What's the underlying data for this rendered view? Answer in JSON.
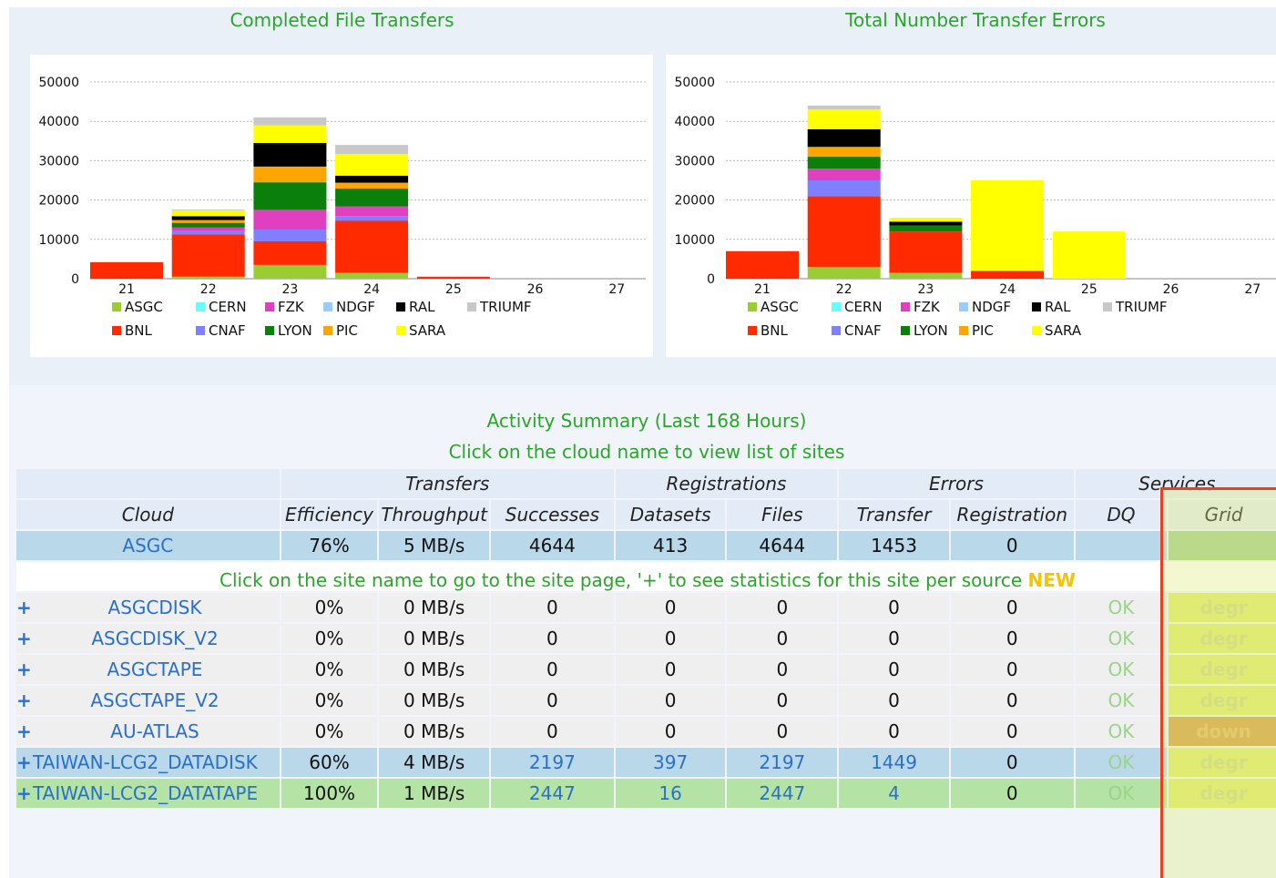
{
  "charts": [
    {
      "title": "Completed File Transfers",
      "chart_data": {
        "type": "bar",
        "stacked": true,
        "categories": [
          "21",
          "22",
          "23",
          "24",
          "25",
          "26",
          "27"
        ],
        "ylim": [
          0,
          50000
        ],
        "yticks": [
          "0",
          "10000",
          "20000",
          "30000",
          "40000",
          "50000"
        ],
        "series": [
          {
            "name": "ASGC",
            "color": "#9acd32",
            "values": [
              0,
              500,
              3500,
              1500,
              0,
              0,
              0
            ]
          },
          {
            "name": "BNL",
            "color": "#ff2a00",
            "values": [
              4200,
              10800,
              6000,
              13200,
              500,
              0,
              0
            ]
          },
          {
            "name": "CERN",
            "color": "#66ffff",
            "values": [
              0,
              0,
              0,
              0,
              0,
              0,
              0
            ]
          },
          {
            "name": "CNAF",
            "color": "#7f7fff",
            "values": [
              0,
              800,
              3000,
              1200,
              0,
              0,
              0
            ]
          },
          {
            "name": "FZK",
            "color": "#e040c0",
            "values": [
              0,
              900,
              5000,
              2500,
              0,
              0,
              0
            ]
          },
          {
            "name": "LYON",
            "color": "#0a7f0a",
            "values": [
              0,
              1200,
              7000,
              4500,
              0,
              0,
              0
            ]
          },
          {
            "name": "NDGF",
            "color": "#99ccff",
            "values": [
              0,
              0,
              0,
              0,
              0,
              0,
              0
            ]
          },
          {
            "name": "PIC",
            "color": "#ffa500",
            "values": [
              0,
              700,
              4000,
              1500,
              0,
              0,
              0
            ]
          },
          {
            "name": "RAL",
            "color": "#000000",
            "values": [
              0,
              1000,
              6000,
              1800,
              0,
              0,
              0
            ]
          },
          {
            "name": "SARA",
            "color": "#ffff00",
            "values": [
              0,
              1500,
              4500,
              5500,
              0,
              0,
              0
            ]
          },
          {
            "name": "TRIUMF",
            "color": "#c8c8c8",
            "values": [
              0,
              200,
              2000,
              2300,
              0,
              0,
              0
            ]
          }
        ],
        "legend_rows": [
          [
            "ASGC",
            "CERN",
            "FZK",
            "NDGF",
            "RAL",
            "TRIUMF"
          ],
          [
            "BNL",
            "CNAF",
            "LYON",
            "PIC",
            "SARA"
          ]
        ],
        "grid": true
      }
    },
    {
      "title": "Total Number Transfer Errors",
      "chart_data": {
        "type": "bar",
        "stacked": true,
        "categories": [
          "21",
          "22",
          "23",
          "24",
          "25",
          "26",
          "27"
        ],
        "ylim": [
          0,
          50000
        ],
        "yticks": [
          "0",
          "10000",
          "20000",
          "30000",
          "40000",
          "50000"
        ],
        "series": [
          {
            "name": "ASGC",
            "color": "#9acd32",
            "values": [
              0,
              3000,
              1500,
              0,
              0,
              0,
              0
            ]
          },
          {
            "name": "BNL",
            "color": "#ff2a00",
            "values": [
              7000,
              18000,
              10500,
              2000,
              0,
              0,
              0
            ]
          },
          {
            "name": "CERN",
            "color": "#66ffff",
            "values": [
              0,
              0,
              0,
              0,
              0,
              0,
              0
            ]
          },
          {
            "name": "CNAF",
            "color": "#7f7fff",
            "values": [
              0,
              4000,
              0,
              0,
              0,
              0,
              0
            ]
          },
          {
            "name": "FZK",
            "color": "#e040c0",
            "values": [
              0,
              3000,
              0,
              0,
              0,
              0,
              0
            ]
          },
          {
            "name": "LYON",
            "color": "#0a7f0a",
            "values": [
              0,
              3000,
              1500,
              0,
              0,
              0,
              0
            ]
          },
          {
            "name": "NDGF",
            "color": "#99ccff",
            "values": [
              0,
              0,
              0,
              0,
              0,
              0,
              0
            ]
          },
          {
            "name": "PIC",
            "color": "#ffa500",
            "values": [
              0,
              2500,
              0,
              0,
              0,
              0,
              0
            ]
          },
          {
            "name": "RAL",
            "color": "#000000",
            "values": [
              0,
              4500,
              1000,
              0,
              0,
              0,
              0
            ]
          },
          {
            "name": "SARA",
            "color": "#ffff00",
            "values": [
              0,
              5000,
              1000,
              23000,
              12000,
              0,
              0
            ]
          },
          {
            "name": "TRIUMF",
            "color": "#c8c8c8",
            "values": [
              0,
              1000,
              0,
              0,
              0,
              0,
              0
            ]
          }
        ],
        "legend_rows": [
          [
            "ASGC",
            "CERN",
            "FZK",
            "NDGF",
            "RAL",
            "TRIUMF"
          ],
          [
            "BNL",
            "CNAF",
            "LYON",
            "PIC",
            "SARA"
          ]
        ],
        "grid": true
      }
    }
  ],
  "summary": {
    "title": "Activity Summary (Last 168 Hours)",
    "subtitle": "Click on the cloud name to view list of sites",
    "group_headers": {
      "transfers": "Transfers",
      "registrations": "Registrations",
      "errors": "Errors",
      "services": "Services"
    },
    "columns": [
      "Cloud",
      "Efficiency",
      "Throughput",
      "Successes",
      "Datasets",
      "Files",
      "Transfer",
      "Registration",
      "DQ",
      "Grid"
    ],
    "cloud_row": {
      "name": "ASGC",
      "efficiency": "76%",
      "throughput": "5 MB/s",
      "successes": "4644",
      "datasets": "413",
      "files": "4644",
      "transfer": "1453",
      "registration": "0",
      "dq": "",
      "grid": ""
    },
    "site_message": "Click on the site name to go to the site page, '+' to see statistics for this site per source",
    "site_message_new": "NEW",
    "sites": [
      {
        "plus": "+",
        "name": "ASGCDISK",
        "efficiency": "0%",
        "throughput": "0 MB/s",
        "successes": "0",
        "datasets": "0",
        "files": "0",
        "transfer": "0",
        "registration": "0",
        "dq": "OK",
        "grid": "degr"
      },
      {
        "plus": "+",
        "name": "ASGCDISK_V2",
        "efficiency": "0%",
        "throughput": "0 MB/s",
        "successes": "0",
        "datasets": "0",
        "files": "0",
        "transfer": "0",
        "registration": "0",
        "dq": "OK",
        "grid": "degr"
      },
      {
        "plus": "+",
        "name": "ASGCTAPE",
        "efficiency": "0%",
        "throughput": "0 MB/s",
        "successes": "0",
        "datasets": "0",
        "files": "0",
        "transfer": "0",
        "registration": "0",
        "dq": "OK",
        "grid": "degr"
      },
      {
        "plus": "+",
        "name": "ASGCTAPE_V2",
        "efficiency": "0%",
        "throughput": "0 MB/s",
        "successes": "0",
        "datasets": "0",
        "files": "0",
        "transfer": "0",
        "registration": "0",
        "dq": "OK",
        "grid": "degr"
      },
      {
        "plus": "+",
        "name": "AU-ATLAS",
        "efficiency": "0%",
        "throughput": "0 MB/s",
        "successes": "0",
        "datasets": "0",
        "files": "0",
        "transfer": "0",
        "registration": "0",
        "dq": "OK",
        "grid": "down"
      },
      {
        "plus": "+",
        "name": "TAIWAN-LCG2_DATADISK",
        "efficiency": "60%",
        "throughput": "4 MB/s",
        "successes": "2197",
        "datasets": "397",
        "files": "2197",
        "transfer": "1449",
        "registration": "0",
        "dq": "OK",
        "grid": "degr"
      },
      {
        "plus": "+",
        "name": "TAIWAN-LCG2_DATATAPE",
        "efficiency": "100%",
        "throughput": "1 MB/s",
        "successes": "2447",
        "datasets": "16",
        "files": "2447",
        "transfer": "4",
        "registration": "0",
        "dq": "OK",
        "grid": "degr"
      }
    ]
  }
}
